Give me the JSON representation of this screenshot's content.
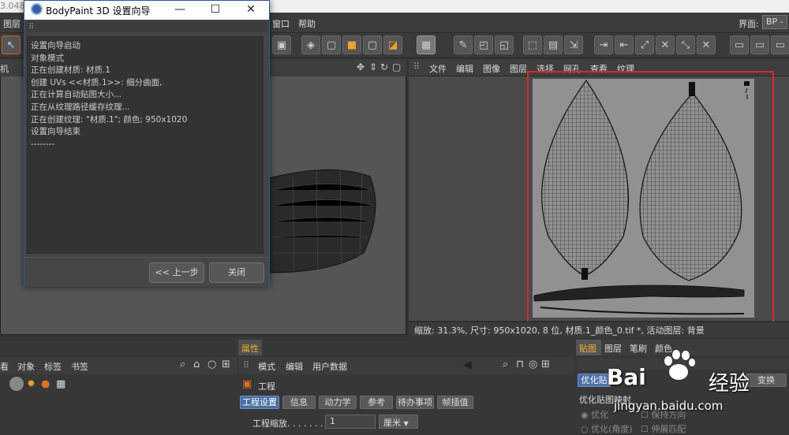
{
  "top": {
    "version_fragment": "3.048"
  },
  "menubar": {
    "items": [
      "图层",
      "窗口",
      "帮助"
    ],
    "layout_label": "界面:",
    "layout_value": "BP -"
  },
  "viewport_left": {
    "tab_label": "机"
  },
  "texture_view": {
    "menu": [
      "文件",
      "编辑",
      "图像",
      "图层",
      "选择",
      "网孔",
      "查看",
      "纹理"
    ],
    "status": "缩放: 31.3%, 尺寸: 950x1020, 8 位, 材质.1_颜色_0.tif *, 活动图层: 背景"
  },
  "dialog": {
    "title": "BodyPaint 3D 设置向导",
    "log": [
      "设置向导启动",
      "对象模式",
      "正在创建材质: 材质.1",
      "创建 UVs <<材质.1>>: 细分曲面,",
      "正在计算自动贴图大小...",
      "正在从纹理路径缓存纹理...",
      "正在创建纹理: \"材质.1\"; 颜色; 950x1020",
      "设置向导结束",
      "--------"
    ],
    "back_button": "<< 上一步",
    "close_button": "关闭"
  },
  "objects_panel": {
    "menu": [
      "看",
      "对象",
      "标签",
      "书签"
    ]
  },
  "attributes_panel": {
    "tab": "属性",
    "menu": [
      "模式",
      "编辑",
      "用户数据"
    ],
    "section_title": "工程",
    "tabs": [
      "工程设置",
      "信息",
      "动力学",
      "参考",
      "待办事项",
      "帧插值"
    ],
    "scale_label": "工程缩放. . . . . . .",
    "scale_value": "1",
    "scale_unit": "厘米"
  },
  "right_panel": {
    "tabs": [
      "贴图",
      "图层",
      "笔刷",
      "颜色"
    ],
    "optimize_button": "优化贴",
    "transform_button": "变换",
    "optimize_mapping_label": "优化贴图映射",
    "options": [
      "优化",
      "优化(角度)",
      "保持方向",
      "伸展匹配"
    ]
  },
  "watermark": {
    "brand": "Bai",
    "brand_cn": "经验",
    "url": "jingyan.baidu.com"
  }
}
